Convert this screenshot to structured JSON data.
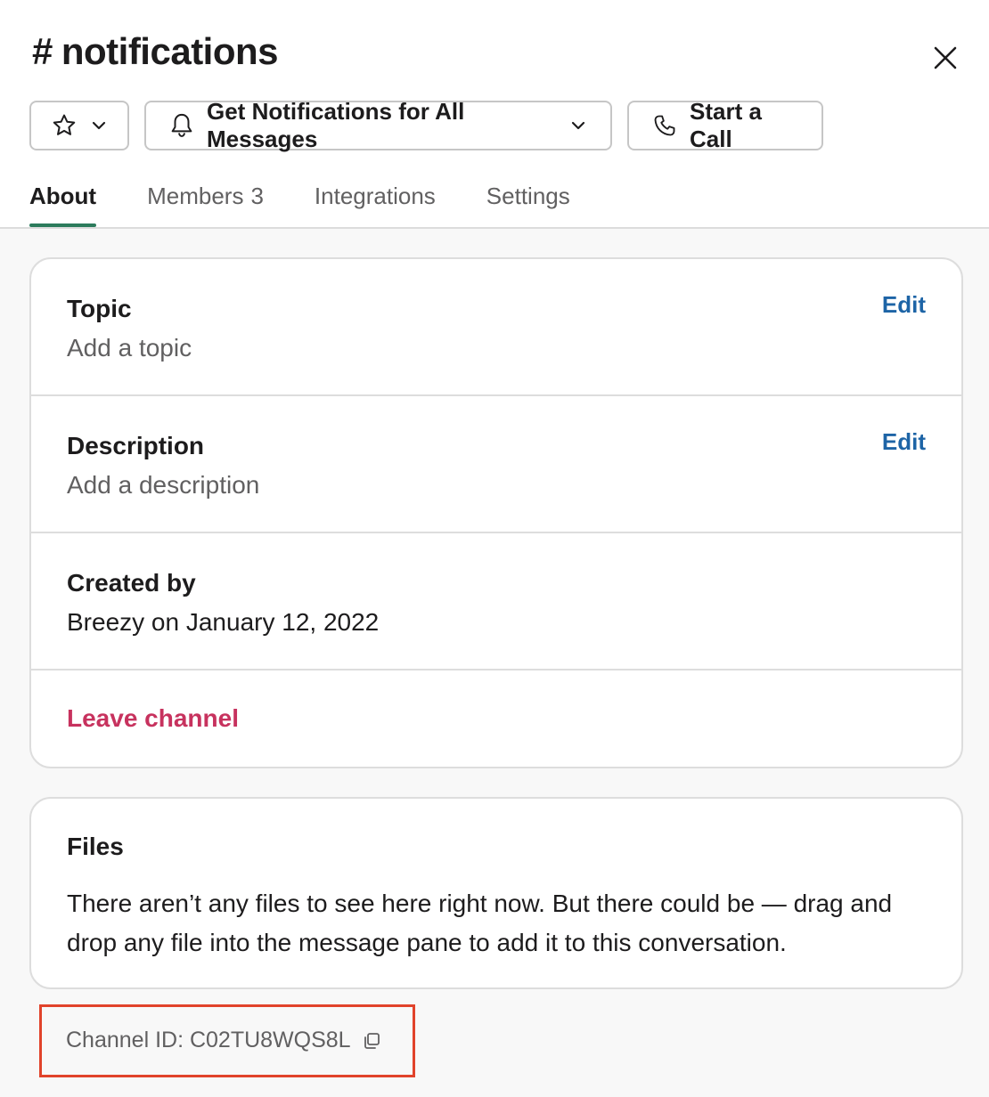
{
  "channel": {
    "hash": "#",
    "name": "notifications"
  },
  "buttons": {
    "notifications_label": "Get Notifications for All Messages",
    "call_label": "Start a Call"
  },
  "tabs": [
    {
      "label": "About",
      "active": true
    },
    {
      "label": "Members",
      "count": "3"
    },
    {
      "label": "Integrations"
    },
    {
      "label": "Settings"
    }
  ],
  "about": {
    "topic": {
      "label": "Topic",
      "value": "Add a topic",
      "edit": "Edit"
    },
    "description": {
      "label": "Description",
      "value": "Add a description",
      "edit": "Edit"
    },
    "created": {
      "label": "Created by",
      "value": "Breezy on January 12, 2022"
    },
    "leave": "Leave channel"
  },
  "files": {
    "label": "Files",
    "text": "There aren’t any files to see here right now. But there could be — drag and drop any file into the message pane to add it to this conversation."
  },
  "channel_id": {
    "text": "Channel ID: C02TU8WQS8L"
  },
  "colors": {
    "accent_tab": "#2c7b5c",
    "link": "#1d64a6",
    "danger": "#c7325e",
    "highlight": "#e1432b"
  },
  "icons": [
    "star-icon",
    "chevron-down-icon",
    "bell-icon",
    "phone-icon",
    "close-icon",
    "copy-icon"
  ]
}
